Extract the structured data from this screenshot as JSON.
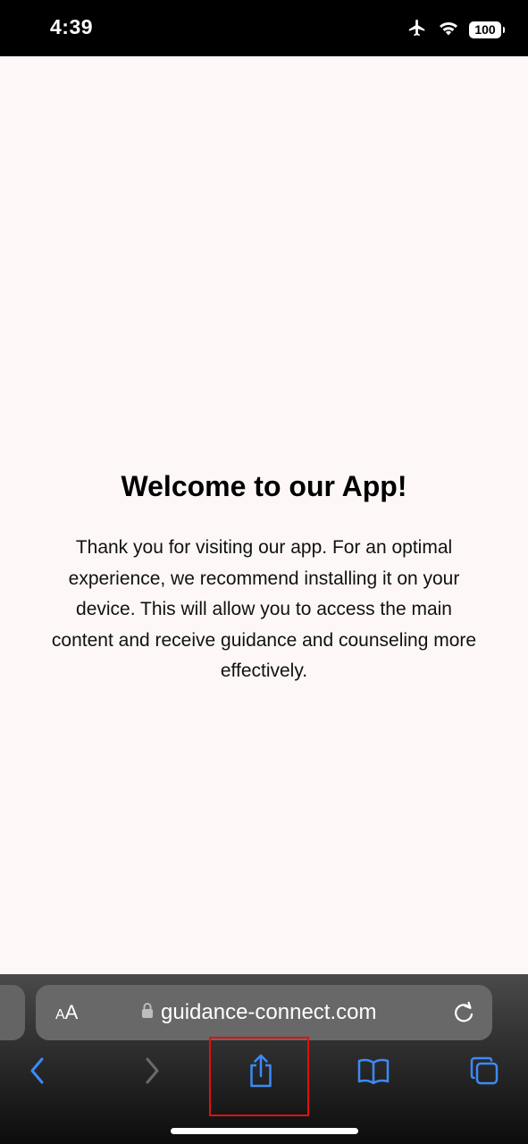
{
  "status_bar": {
    "time": "4:39",
    "battery_level": "100",
    "icons": [
      "airplane-mode-icon",
      "wifi-icon",
      "battery-icon"
    ]
  },
  "page": {
    "title": "Welcome to our App!",
    "body": "Thank you for visiting our app. For an optimal experience, we recommend installing it on your device. This will allow you to access the main content and receive guidance and counseling more effectively."
  },
  "browser": {
    "text_size_button_small": "A",
    "text_size_button_large": "A",
    "url": "guidance-connect.com",
    "toolbar": [
      "back-icon",
      "forward-icon",
      "share-icon",
      "bookmarks-icon",
      "tabs-icon"
    ],
    "accent_color": "#3d8af7",
    "disabled_color": "#6b6b6b",
    "highlight_color": "#e01010"
  }
}
